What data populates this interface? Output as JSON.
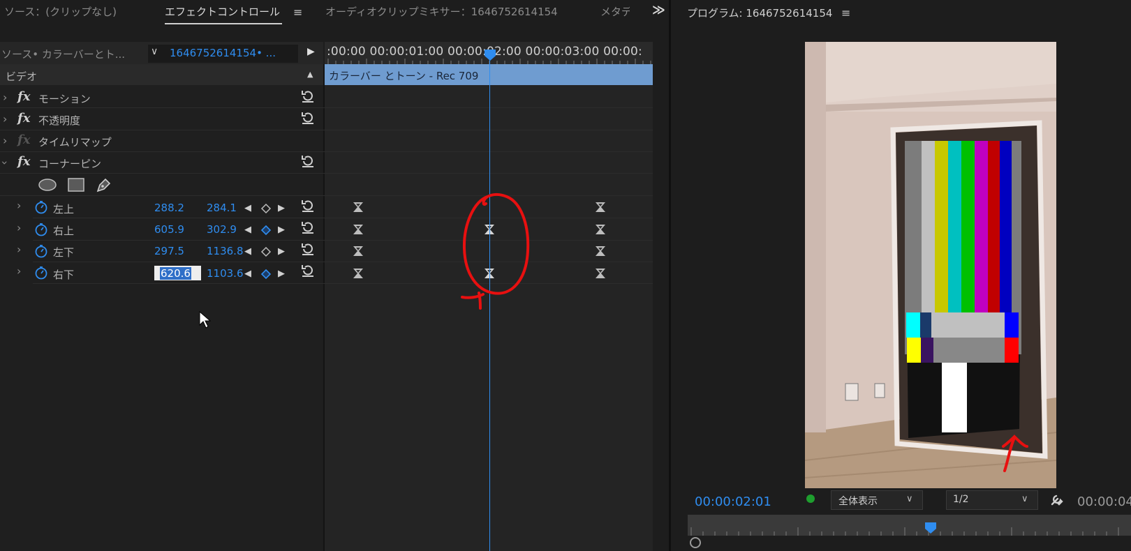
{
  "tabs": {
    "source": "ソース：(クリップなし)",
    "effect_controls": "エフェクトコントロール",
    "audio_mixer": "オーディオクリップミキサー：1646752614154",
    "metadata": "メタデ",
    "more": "≫"
  },
  "program": {
    "title": "プログラム: 1646752614154",
    "timecode": "00:00:02:01",
    "fit": "全体表示",
    "resolution": "1/2",
    "duration": "00:00:04"
  },
  "source_bar": {
    "source_label": "ソース• カラーバーとト...",
    "sequence_label": "1646752614154• ..."
  },
  "timeline": {
    "ruler_text": ":00:00 00:00:01:00 00:00:02:00 00:00:03:00 00:00:",
    "clip_label": "カラーバー とトーン - Rec 709"
  },
  "effects": {
    "video_header": "ビデオ",
    "motion": "モーション",
    "opacity": "不透明度",
    "time_remap": "タイムリマップ",
    "corner_pin": "コーナーピン"
  },
  "params": [
    {
      "label": "左上",
      "x": "288.2",
      "y": "284.1"
    },
    {
      "label": "右上",
      "x": "605.9",
      "y": "302.9"
    },
    {
      "label": "左下",
      "x": "297.5",
      "y": "1136.8"
    },
    {
      "label": "右下",
      "x": "620.6",
      "y": "1103.6"
    }
  ],
  "colors": {
    "accent": "#2f8df0",
    "clip": "#6f9cd0",
    "annotation": "#e81010",
    "panel": "#1f1f1f"
  }
}
